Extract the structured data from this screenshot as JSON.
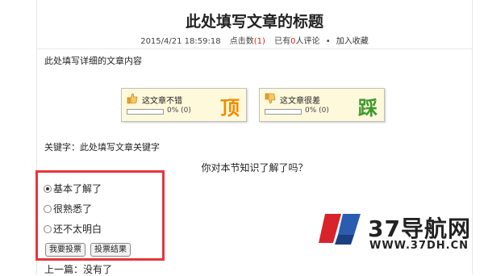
{
  "article": {
    "title": "此处填写文章的标题",
    "date": "2015/4/21 18:59:18",
    "clicks_label": "点击数",
    "clicks_count": "(1)",
    "comments_prefix": "已有",
    "comments_count": "0",
    "comments_suffix": "人评论",
    "bullet": "•",
    "favorite_link": "加入收藏",
    "body": "此处填写详细的文章内容",
    "keywords": "关键字：此处填写文章关键字",
    "prev": "上一篇：没有了"
  },
  "votes": {
    "good": {
      "label": "这文章不错",
      "pct": "0% (0)",
      "big": "顶",
      "color": "#f08c00",
      "fill": 0
    },
    "bad": {
      "label": "这文章很差",
      "pct": "0% (0)",
      "big": "踩",
      "color": "#3a9a2a",
      "fill": 0
    }
  },
  "poll": {
    "question": "你对本节知识了解了吗？",
    "options": [
      "基本了解了",
      "很熟悉了",
      "还不太明白"
    ],
    "selected_index": 0,
    "vote_button": "我要投票",
    "results_button": "投票结果",
    "highlight_color": "#e8353a"
  },
  "watermark": {
    "name": "37导航网",
    "url": "WWW.37DH.CN"
  }
}
